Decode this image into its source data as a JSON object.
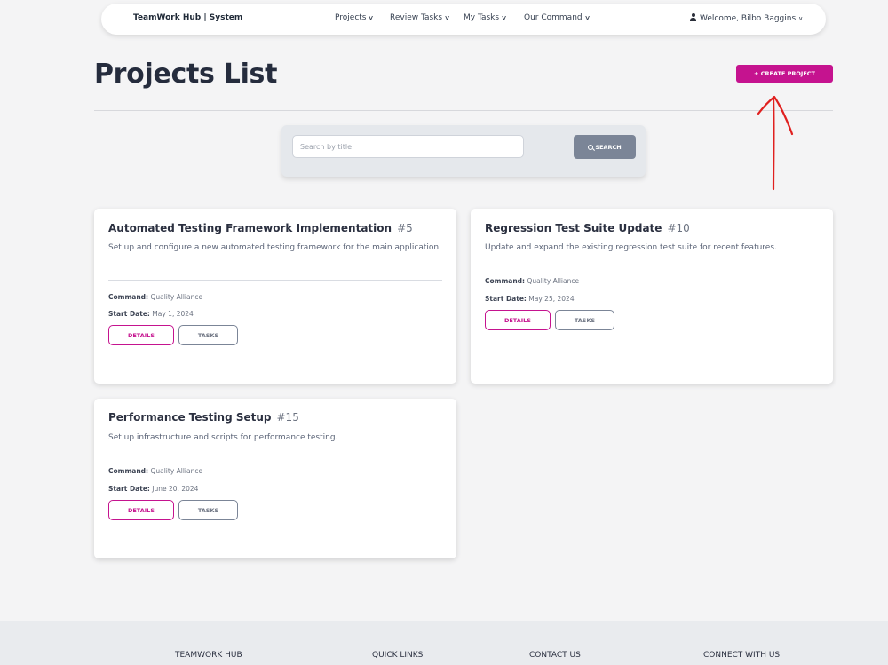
{
  "navbar": {
    "brand": "TeamWork Hub | System",
    "items": [
      {
        "label": "Projects"
      },
      {
        "label": "Review Tasks"
      },
      {
        "label": "My Tasks"
      },
      {
        "label": "Our Command"
      }
    ],
    "user_label": "Welcome, Bilbo Baggins"
  },
  "header": {
    "title": "Projects List",
    "create_label": "+ CREATE PROJECT"
  },
  "search": {
    "placeholder": "Search by title",
    "value": "",
    "button_label": "SEARCH"
  },
  "meta_labels": {
    "command": "Command:",
    "start_date": "Start Date:"
  },
  "projects": [
    {
      "title": "Automated Testing Framework Implementation",
      "id": "#5",
      "description": "Set up and configure a new automated testing framework for the main application.",
      "command": "Quality Alliance",
      "start_date": "May 1, 2024",
      "details_label": "DETAILS",
      "tasks_label": "TASKS"
    },
    {
      "title": "Regression Test Suite Update",
      "id": "#10",
      "description": "Update and expand the existing regression test suite for recent features.",
      "command": "Quality Alliance",
      "start_date": "May 25, 2024",
      "details_label": "DETAILS",
      "tasks_label": "TASKS"
    },
    {
      "title": "Performance Testing Setup",
      "id": "#15",
      "description": "Set up infrastructure and scripts for performance testing.",
      "command": "Quality Alliance",
      "start_date": "June 20, 2024",
      "details_label": "DETAILS",
      "tasks_label": "TASKS"
    }
  ],
  "footer": {
    "columns": [
      {
        "heading": "TEAMWORK HUB"
      },
      {
        "heading": "QUICK LINKS"
      },
      {
        "heading": "CONTACT US"
      },
      {
        "heading": "CONNECT WITH US"
      }
    ]
  },
  "colors": {
    "accent": "#c5138f",
    "annotation": "#e0201f",
    "search_button": "#7b8597"
  }
}
